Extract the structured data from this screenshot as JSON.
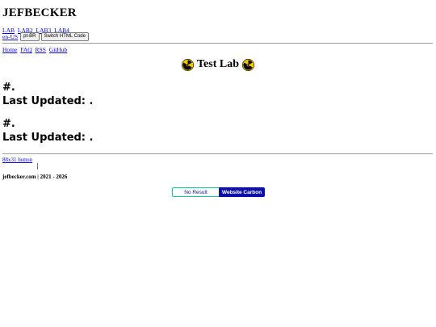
{
  "site": {
    "title": "JEFBECKER"
  },
  "labs": [
    "LAB",
    "LAB2",
    "LAB3",
    "LAB4"
  ],
  "lang": {
    "link": "en-US",
    "button": "pt-BR",
    "switch": "Switch HTML Code"
  },
  "nav": [
    "Home",
    "FAQ",
    "RSS",
    "GitHub"
  ],
  "heading": {
    "text": "Test Lab",
    "icon": "radioactive-icon",
    "icon_color": "#f5c400"
  },
  "entries": [
    {
      "hash": "#.",
      "updated": "Last Updated: ."
    },
    {
      "hash": "#.",
      "updated": "Last Updated: ."
    }
  ],
  "footer": {
    "button_alt": "88x31 button",
    "copyright": "jefbecker.com | 2021 - 2026",
    "carbon_result": "No Result",
    "carbon_label": "Website Carbon",
    "carbon_color": "#0e11a8",
    "carbon_border_color": "#00d2a0"
  }
}
